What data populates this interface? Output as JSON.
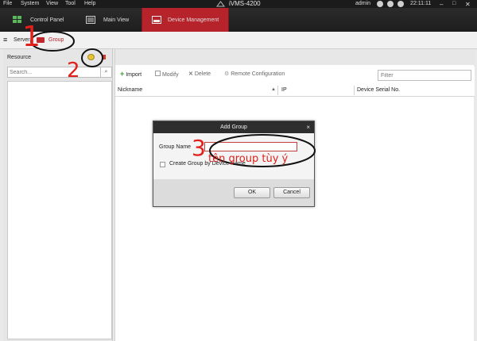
{
  "menu": {
    "items": [
      "File",
      "System",
      "View",
      "Tool",
      "Help"
    ],
    "app_title": "iVMS-4200",
    "user": "admin",
    "clock": "22:11:11"
  },
  "tabs": [
    {
      "label": "Control Panel",
      "active": false
    },
    {
      "label": "Main View",
      "active": false
    },
    {
      "label": "Device Management",
      "active": true
    }
  ],
  "subbar": {
    "server_label": "Server",
    "group_label": "Group"
  },
  "left": {
    "resource_label": "Resource",
    "search_placeholder": "Search..."
  },
  "toolbar": {
    "import_label": "Import",
    "modify_label": "Modify",
    "delete_label": "Delete",
    "remote_config_label": "Remote Configuration",
    "filter_placeholder": "Filter"
  },
  "table": {
    "columns": [
      "Nickname",
      "IP",
      "Device Serial No."
    ]
  },
  "dialog": {
    "title": "Add Group",
    "group_name_label": "Group Name",
    "group_name_value": "",
    "checkbox_label": "Create Group by Device Name",
    "checkbox_checked": false,
    "ok_label": "OK",
    "cancel_label": "Cancel"
  },
  "annotations": {
    "step1": "1",
    "step2": "2",
    "step3": "3",
    "note": "tên group tùy ý"
  },
  "colors": {
    "accent_red": "#b6232a",
    "annotation_red": "#e0201a",
    "import_green": "#3a9a2e"
  }
}
